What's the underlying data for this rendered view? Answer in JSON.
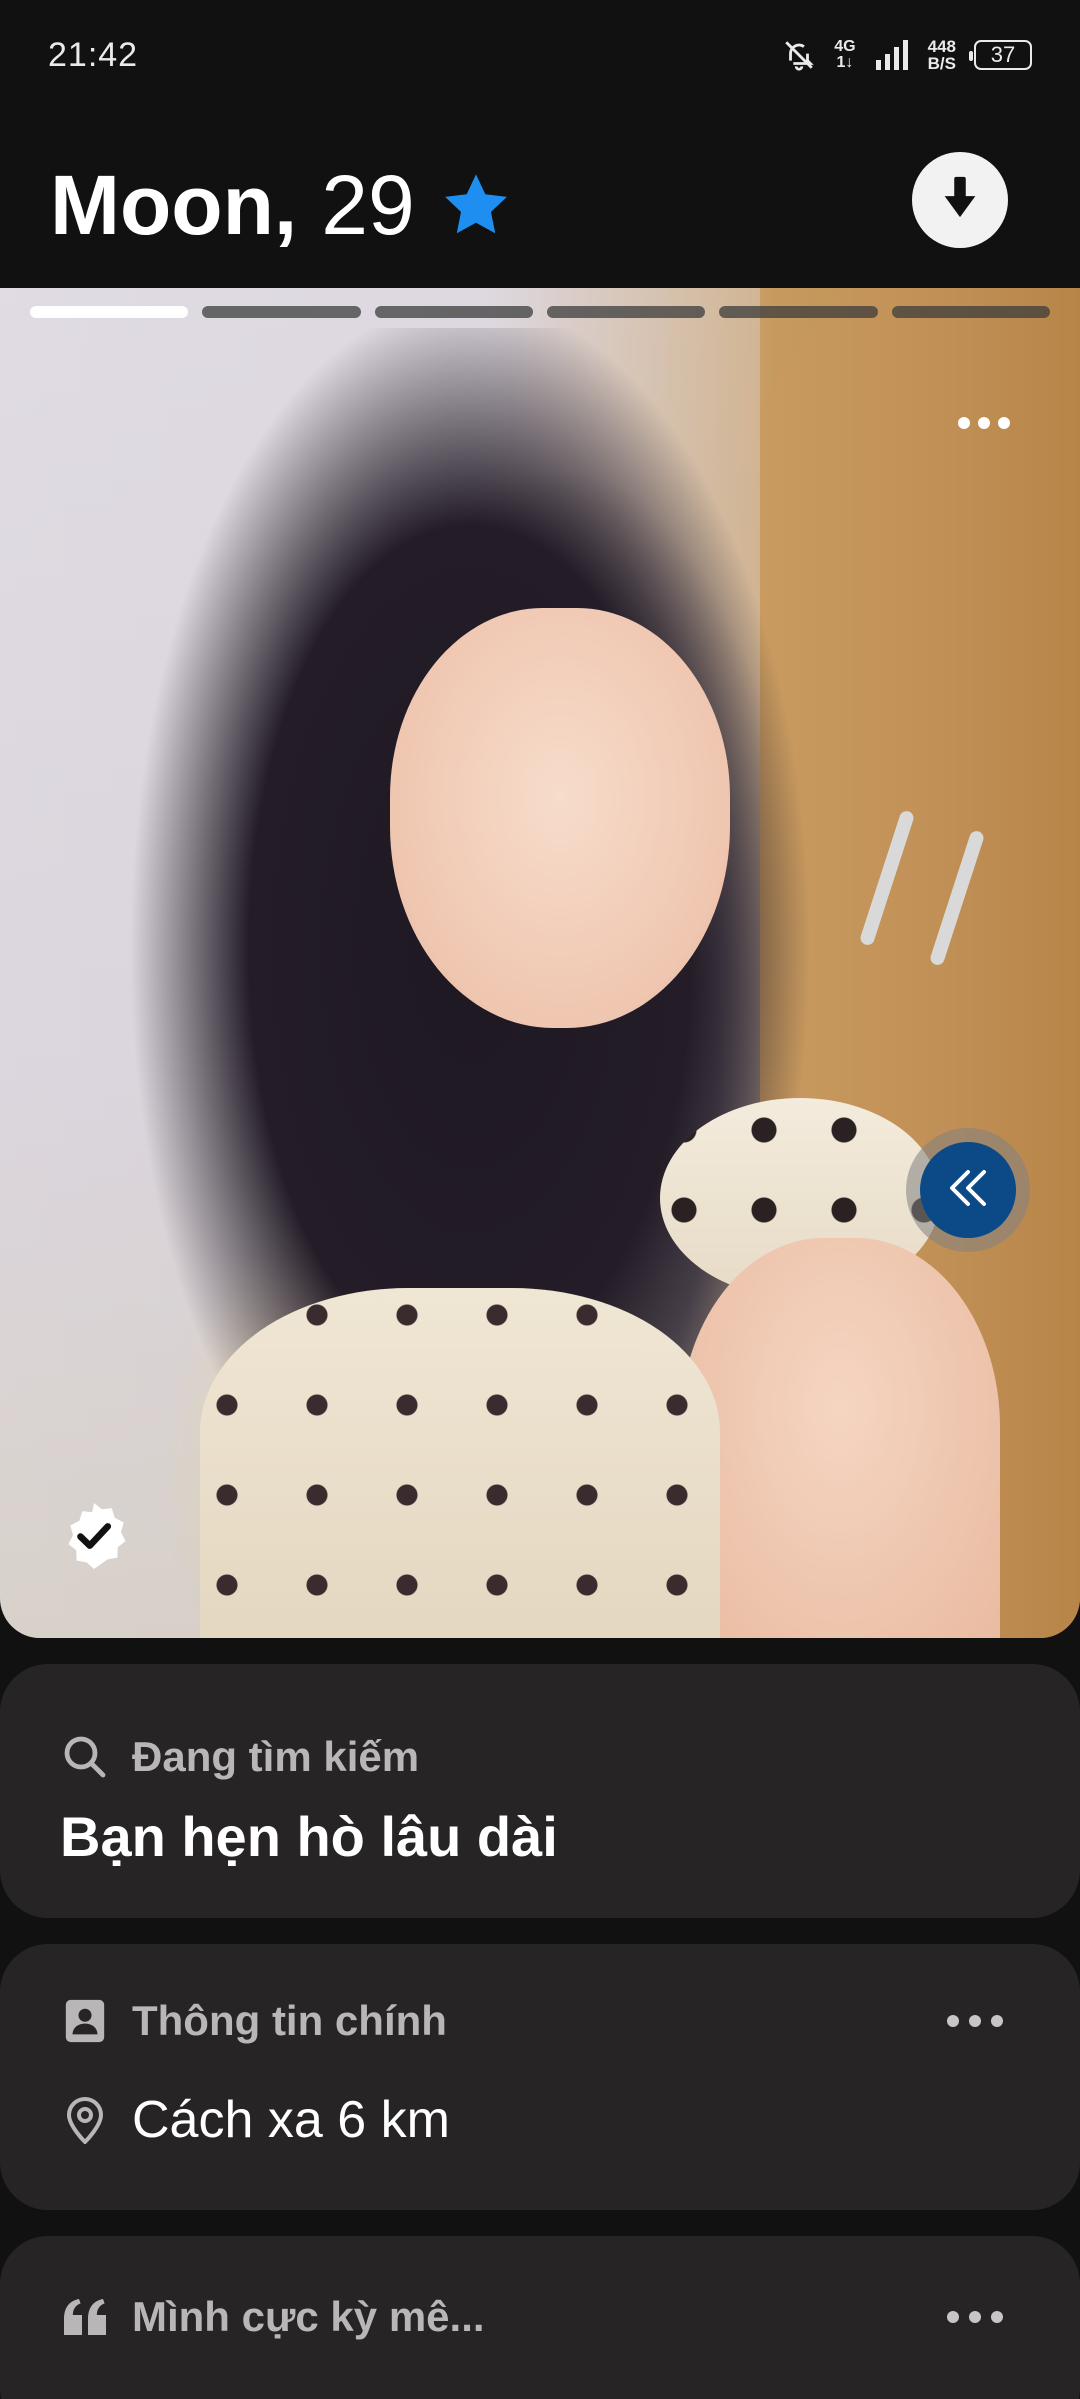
{
  "status_bar": {
    "time": "21:42",
    "network_top": "4G",
    "network_bottom": "1↓",
    "speed_value": "448",
    "speed_unit": "B/S",
    "battery": "37",
    "icons": [
      "bell-off-icon",
      "signal-icon",
      "battery-icon"
    ]
  },
  "profile": {
    "name": "Moon,",
    "age": "29",
    "badge_icon": "star-icon",
    "collapse_icon": "arrow-down-icon",
    "photo_count": 6,
    "photo_active_index": 0,
    "verified_icon": "verified-check-icon"
  },
  "looking_for": {
    "icon": "search-icon",
    "label": "Đang tìm kiếm",
    "value": "Bạn hẹn hò lâu dài"
  },
  "basics": {
    "icon": "id-card-icon",
    "label": "Thông tin chính",
    "distance_icon": "location-pin-icon",
    "distance": "Cách xa 6 km"
  },
  "bio": {
    "icon": "quote-icon",
    "label": "Mình cực kỳ mê..."
  },
  "colors": {
    "background": "#111111",
    "card": "#272425",
    "accent_blue": "#1e8ff0",
    "rewind_blue": "#0b4a86"
  }
}
